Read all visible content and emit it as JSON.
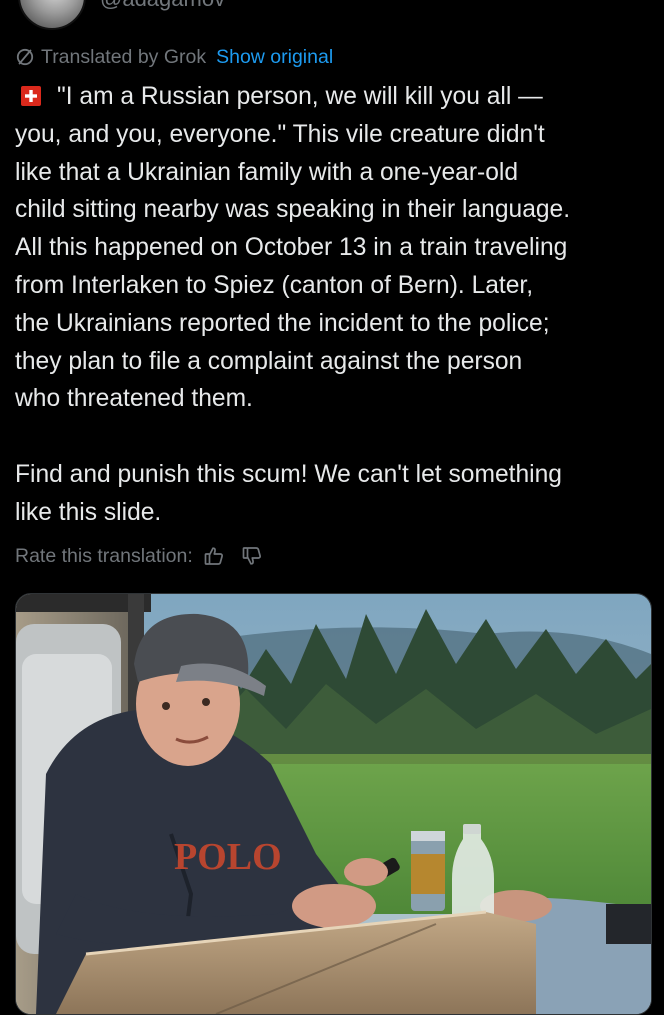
{
  "author": {
    "handle": "@adagamov"
  },
  "translation": {
    "label": "Translated by Grok",
    "show_original": "Show original"
  },
  "tweet": {
    "lines": [
      "\"I am a Russian person, we will kill you all —",
      "you, and you, everyone.\" This vile creature didn't",
      "like that a Ukrainian family with a one-year-old",
      "child sitting nearby was speaking in their language.",
      "All this happened on October 13 in a train traveling",
      "from Interlaken to Spiez (canton of Bern). Later,",
      "the Ukrainians reported the incident to the police;",
      "they plan to file a complaint against the person",
      "who threatened them.",
      "Find and punish this scum! We can't let something",
      "like this slide."
    ]
  },
  "rating": {
    "label": "Rate this translation:"
  },
  "media": {
    "cap_text": "POLO"
  },
  "colors": {
    "background": "#000000",
    "text": "#e7e9ea",
    "secondary": "#71767b",
    "link": "#1d9bf0",
    "flag_red": "#da291c"
  },
  "icons": {
    "translate": "slashed-circle-icon",
    "flag": "swiss-flag-icon",
    "like": "thumbs-up-icon",
    "dislike": "thumbs-down-icon"
  }
}
